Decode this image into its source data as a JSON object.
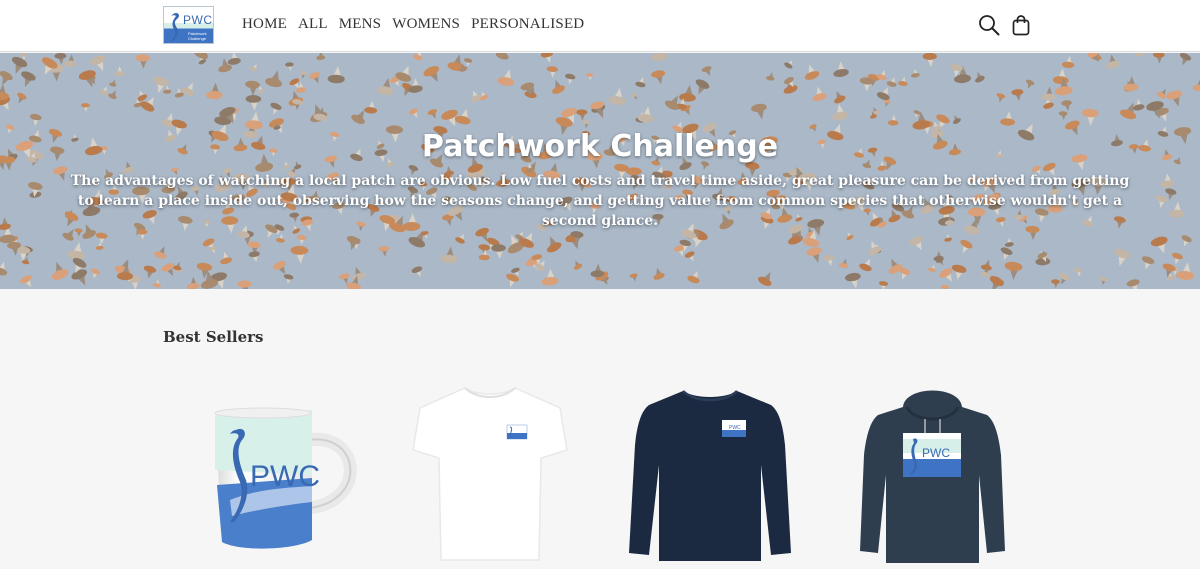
{
  "brand": {
    "logo_text": "PWC",
    "logo_sub": "Patchwork Challenge",
    "colors": {
      "blue": "#3f74c4",
      "mint": "#d6efe9",
      "navy": "#1b2a41",
      "slate": "#2e3e4f"
    }
  },
  "nav": {
    "items": [
      {
        "label": "HOME"
      },
      {
        "label": "ALL"
      },
      {
        "label": "MENS"
      },
      {
        "label": "WOMENS"
      },
      {
        "label": "PERSONALISED"
      }
    ]
  },
  "header_icons": {
    "search": "search-icon",
    "cart": "shopping-bag-icon"
  },
  "hero": {
    "title": "Patchwork Challenge",
    "text": "The advantages of watching a local patch are obvious. Low fuel costs and travel time aside, great pleasure can be derived from getting to learn a place inside out, observing how the seasons change, and getting value from common species that otherwise wouldn't get a second glance."
  },
  "best_sellers": {
    "title": "Best Sellers",
    "products": [
      {
        "kind": "mug",
        "print_text": "PWC",
        "print_sub": "Patchwork Challenge"
      },
      {
        "kind": "t-shirt",
        "color": "white"
      },
      {
        "kind": "long-sleeve-top",
        "color": "navy"
      },
      {
        "kind": "hoodie",
        "color": "dark slate",
        "print_text": "PWC",
        "print_sub": "Patchwork Challenge"
      }
    ]
  }
}
